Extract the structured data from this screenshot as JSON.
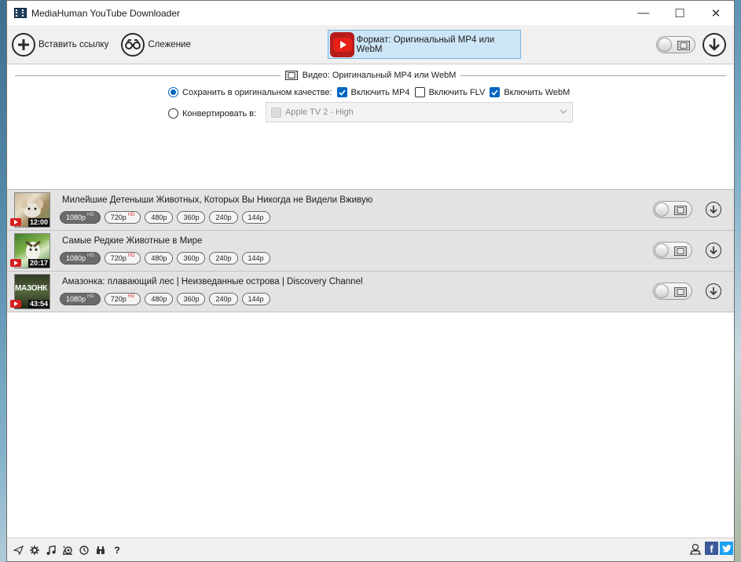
{
  "window": {
    "title": "MediaHuman YouTube Downloader",
    "minimize": "—",
    "maximize": "☐",
    "close": "✕"
  },
  "toolbar": {
    "paste_label": "Вставить ссылку",
    "tracking_label": "Слежение",
    "format_label": "Формат: Оригинальный MP4 или WebM"
  },
  "settings": {
    "section_title": "Видео: Оригинальный MP4 или WebM",
    "save_original_label": "Сохранить в оригинальном качестве:",
    "include_mp4": "Включить MP4",
    "include_flv": "Включить FLV",
    "include_webm": "Включить WebM",
    "include_mp4_checked": true,
    "include_flv_checked": false,
    "include_webm_checked": true,
    "convert_label": "Конвертировать в:",
    "convert_value": "Apple TV 2 - High",
    "selected_mode": "save_original"
  },
  "videos": [
    {
      "title": "Милейшие Детеныши Животных, Которых Вы Никогда не Видели Вживую",
      "duration": "12:00",
      "qualities": [
        {
          "label": "1080p",
          "tag": "HD",
          "selected": true
        },
        {
          "label": "720p",
          "tag": "HD",
          "selected": false
        },
        {
          "label": "480p",
          "tag": "",
          "selected": false
        },
        {
          "label": "360p",
          "tag": "",
          "selected": false
        },
        {
          "label": "240p",
          "tag": "",
          "selected": false
        },
        {
          "label": "144p",
          "tag": "",
          "selected": false
        }
      ]
    },
    {
      "title": "Самые Редкие Животные в Мире",
      "duration": "20:17",
      "qualities": [
        {
          "label": "1080p",
          "tag": "HD",
          "selected": true
        },
        {
          "label": "720p",
          "tag": "HD",
          "selected": false
        },
        {
          "label": "480p",
          "tag": "",
          "selected": false
        },
        {
          "label": "360p",
          "tag": "",
          "selected": false
        },
        {
          "label": "240p",
          "tag": "",
          "selected": false
        },
        {
          "label": "144p",
          "tag": "",
          "selected": false
        }
      ]
    },
    {
      "title": "Амазонка: плавающий лес | Неизведанные острова | Discovery Channel",
      "duration": "43:54",
      "thumb_text": "МАЗОНК",
      "qualities": [
        {
          "label": "1080p",
          "tag": "HD",
          "selected": true
        },
        {
          "label": "720p",
          "tag": "HD",
          "selected": false
        },
        {
          "label": "480p",
          "tag": "",
          "selected": false
        },
        {
          "label": "360p",
          "tag": "",
          "selected": false
        },
        {
          "label": "240p",
          "tag": "",
          "selected": false
        },
        {
          "label": "144p",
          "tag": "",
          "selected": false
        }
      ]
    }
  ],
  "statusbar": {
    "left_icons": [
      "send-icon",
      "gear-icon",
      "music-icon",
      "snail-icon",
      "clock-icon",
      "binoculars-icon",
      "help-icon"
    ],
    "help_glyph": "?",
    "right_icons": [
      "support-icon",
      "facebook-icon",
      "twitter-icon"
    ],
    "facebook_glyph": "f"
  },
  "colors": {
    "accent": "#0067c0",
    "format_button_bg": "#cde6f7",
    "youtube_red": "#d41f1f",
    "row_bg": "#e3e3e3"
  }
}
